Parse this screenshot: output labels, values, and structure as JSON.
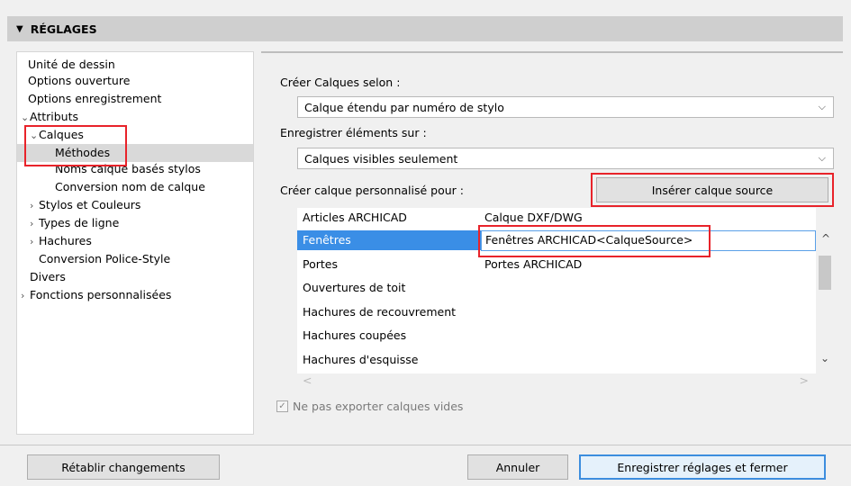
{
  "header": {
    "title": "RÉGLAGES",
    "toggle_glyph": "▼"
  },
  "tree": {
    "items": [
      {
        "label": "Unité de dessin",
        "chev": ""
      },
      {
        "label": "Options ouverture",
        "chev": ""
      },
      {
        "label": "Options enregistrement",
        "chev": ""
      },
      {
        "label": "Attributs",
        "chev": "⌄"
      },
      {
        "label": "Calques",
        "chev": "⌄"
      },
      {
        "label": "Méthodes",
        "chev": ""
      },
      {
        "label": "Noms calque basés stylos",
        "chev": ""
      },
      {
        "label": "Conversion nom de calque",
        "chev": ""
      },
      {
        "label": "Stylos et Couleurs",
        "chev": "›"
      },
      {
        "label": "Types de ligne",
        "chev": "›"
      },
      {
        "label": "Hachures",
        "chev": "›"
      },
      {
        "label": "Conversion Police-Style",
        "chev": ""
      },
      {
        "label": "Divers",
        "chev": ""
      },
      {
        "label": "Fonctions personnalisées",
        "chev": "›"
      }
    ]
  },
  "form": {
    "create_layers_label": "Créer Calques selon :",
    "create_layers_value": "Calque étendu par numéro de stylo",
    "save_elements_label": "Enregistrer éléments sur :",
    "save_elements_value": "Calques visibles seulement",
    "custom_layer_label": "Créer calque personnalisé pour :",
    "insert_source_button": "Insérer calque source",
    "caret_glyph": "⌵"
  },
  "table": {
    "rows": [
      {
        "element": "Articles ARCHICAD",
        "layer": "Calque DXF/DWG"
      },
      {
        "element": "Fenêtres",
        "layer": "Fenêtres ARCHICAD<CalqueSource>"
      },
      {
        "element": "Portes",
        "layer": "Portes ARCHICAD"
      },
      {
        "element": "Ouvertures de toit",
        "layer": ""
      },
      {
        "element": "Hachures de recouvrement",
        "layer": ""
      },
      {
        "element": "Hachures coupées",
        "layer": ""
      },
      {
        "element": "Hachures d'esquisse",
        "layer": ""
      }
    ],
    "scroll_up": "^",
    "scroll_down": "⌄",
    "scroll_left": "<",
    "scroll_right": ">"
  },
  "checkbox": {
    "label": "Ne pas exporter calques vides",
    "checked": true,
    "glyph": "✓"
  },
  "footer": {
    "reset_button": "Rétablir changements",
    "cancel_button": "Annuler",
    "save_button": "Enregistrer réglages et fermer"
  },
  "colors": {
    "selection": "#3a8ee6",
    "highlight_box": "#e8232a",
    "primary_border": "#3c8dde"
  }
}
